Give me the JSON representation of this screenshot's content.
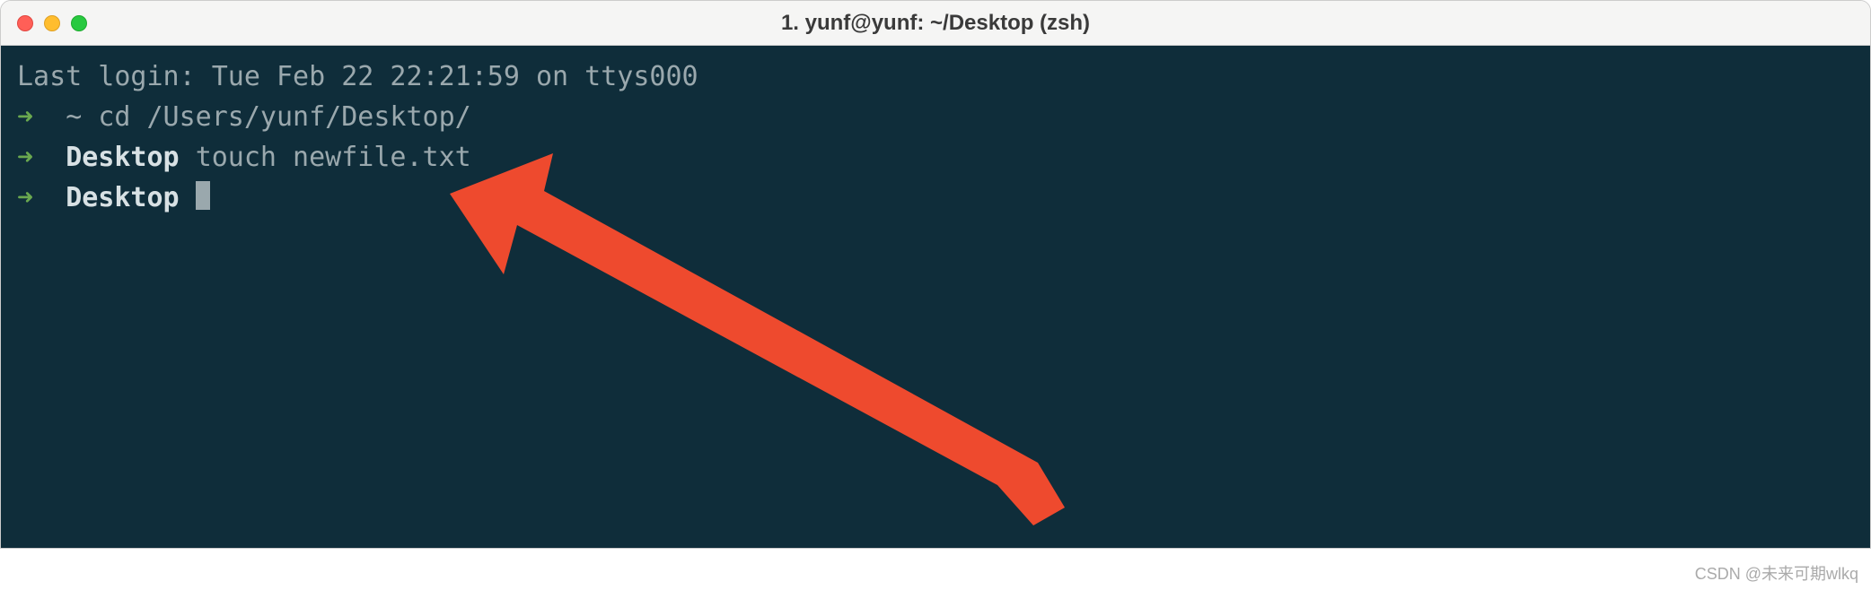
{
  "window": {
    "title": "1. yunf@yunf: ~/Desktop (zsh)"
  },
  "terminal": {
    "last_login": "Last login: Tue Feb 22 22:21:59 on ttys000",
    "lines": [
      {
        "arrow": "➜",
        "cwd": "~",
        "command": "cd /Users/yunf/Desktop/"
      },
      {
        "arrow": "➜",
        "cwd": "Desktop",
        "command": "touch newfile.txt"
      },
      {
        "arrow": "➜",
        "cwd": "Desktop",
        "command": ""
      }
    ]
  },
  "watermark": "CSDN @未来可期wlkq"
}
